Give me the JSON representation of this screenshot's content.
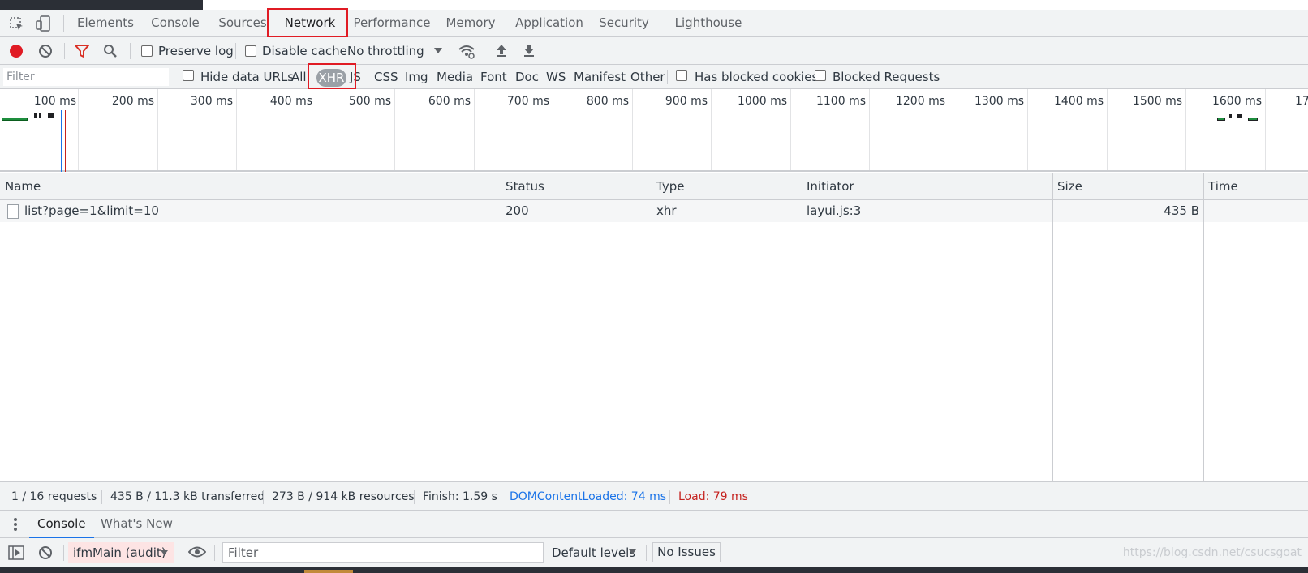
{
  "panel_tabs": [
    "Elements",
    "Console",
    "Sources",
    "Network",
    "Performance",
    "Memory",
    "Application",
    "Security",
    "Lighthouse"
  ],
  "active_panel_tab": "Network",
  "toolbar": {
    "preserve_log": "Preserve log",
    "disable_cache": "Disable cache",
    "throttling": "No throttling",
    "record_color": "#e01b24",
    "filter_icon_color": "#d93025"
  },
  "filter_row": {
    "placeholder": "Filter",
    "hide_data_urls": "Hide data URLs",
    "types": [
      "All",
      "XHR",
      "JS",
      "CSS",
      "Img",
      "Media",
      "Font",
      "Doc",
      "WS",
      "Manifest",
      "Other"
    ],
    "active_type": "XHR",
    "has_blocked_cookies": "Has blocked cookies",
    "blocked_requests": "Blocked Requests"
  },
  "overview": {
    "tick_labels": [
      "100 ms",
      "200 ms",
      "300 ms",
      "400 ms",
      "500 ms",
      "600 ms",
      "700 ms",
      "800 ms",
      "900 ms",
      "1000 ms",
      "1100 ms",
      "1200 ms",
      "1300 ms",
      "1400 ms",
      "1500 ms",
      "1600 ms",
      "17"
    ]
  },
  "table": {
    "columns": [
      "Name",
      "Status",
      "Type",
      "Initiator",
      "Size",
      "Time"
    ],
    "rows": [
      {
        "name": "list?page=1&limit=10",
        "status": "200",
        "type": "xhr",
        "initiator": "layui.js:3",
        "size": "435 B",
        "time": ""
      }
    ]
  },
  "summary": {
    "requests": "1 / 16 requests",
    "transferred": "435 B / 11.3 kB transferred",
    "resources": "273 B / 914 kB resources",
    "finish": "Finish: 1.59 s",
    "dom_content_loaded": "DOMContentLoaded: 74 ms",
    "load": "Load: 79 ms",
    "dcl_color": "#1a73e8",
    "load_color": "#c5221f"
  },
  "drawer": {
    "tabs": [
      "Console",
      "What's New"
    ],
    "active_tab": "Console",
    "context": "ifmMain (audit)",
    "filter_placeholder": "Filter",
    "levels": "Default levels",
    "issues": "No Issues"
  },
  "watermark": "https://blog.csdn.net/csucsgoat"
}
